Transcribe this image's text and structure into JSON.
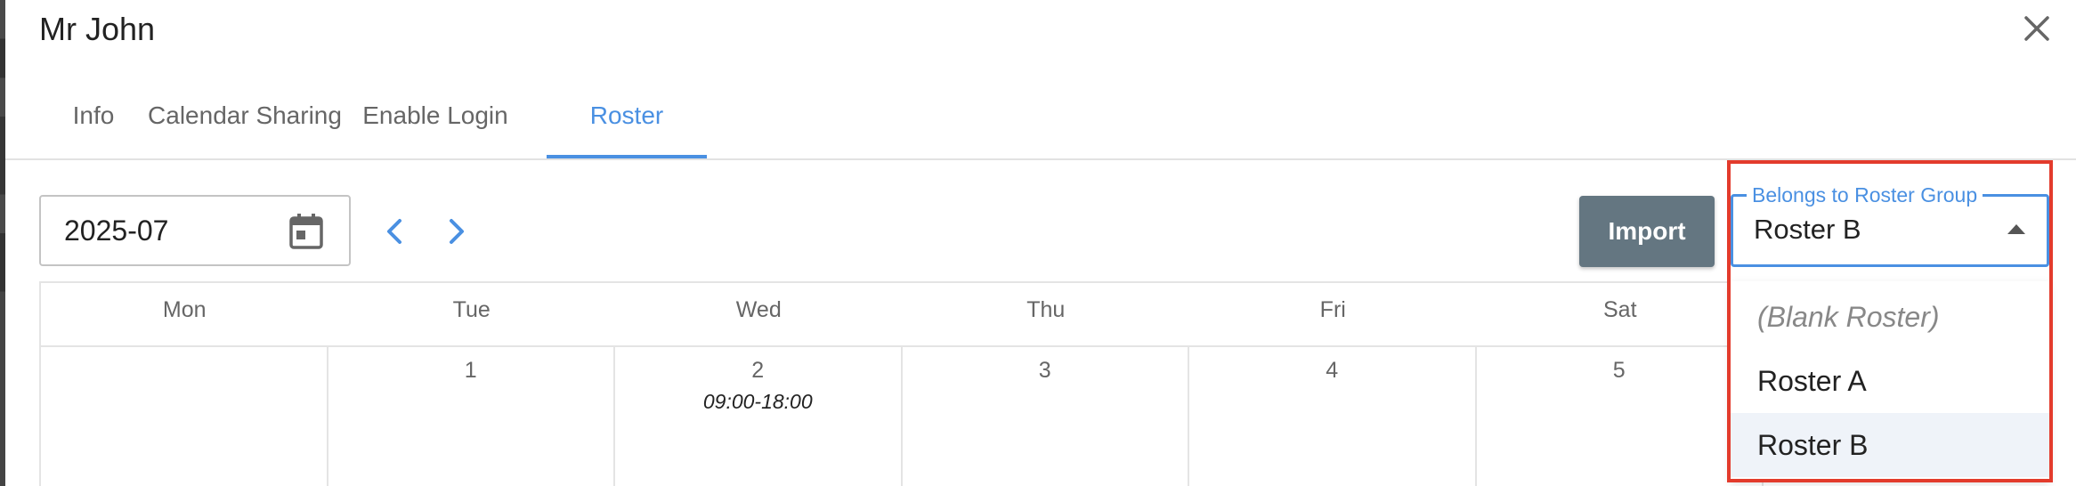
{
  "modal": {
    "title": "Mr John"
  },
  "tabs": [
    {
      "label": "Info",
      "active": false
    },
    {
      "label": "Calendar Sharing",
      "active": false
    },
    {
      "label": "Enable Login",
      "active": false
    },
    {
      "label": "Roster",
      "active": true
    }
  ],
  "toolbar": {
    "month_value": "2025-07",
    "import_label": "Import"
  },
  "roster_group": {
    "label": "Belongs to Roster Group",
    "selected": "Roster B",
    "options": [
      "(Blank Roster)",
      "Roster A",
      "Roster B"
    ]
  },
  "calendar": {
    "weekdays": [
      "Mon",
      "Tue",
      "Wed",
      "Thu",
      "Fri",
      "Sat"
    ],
    "week1": [
      {
        "day": "",
        "shift": ""
      },
      {
        "day": "1",
        "shift": ""
      },
      {
        "day": "2",
        "shift": "09:00-18:00"
      },
      {
        "day": "3",
        "shift": ""
      },
      {
        "day": "4",
        "shift": ""
      },
      {
        "day": "5",
        "shift": ""
      }
    ]
  },
  "colors": {
    "accent": "#4a90e2",
    "import_button": "#647681",
    "highlight": "#e33b2c"
  },
  "icons": {
    "close": "close-icon",
    "calendar": "calendar-icon",
    "prev": "chevron-left-icon",
    "next": "chevron-right-icon",
    "caret": "caret-up-icon"
  }
}
